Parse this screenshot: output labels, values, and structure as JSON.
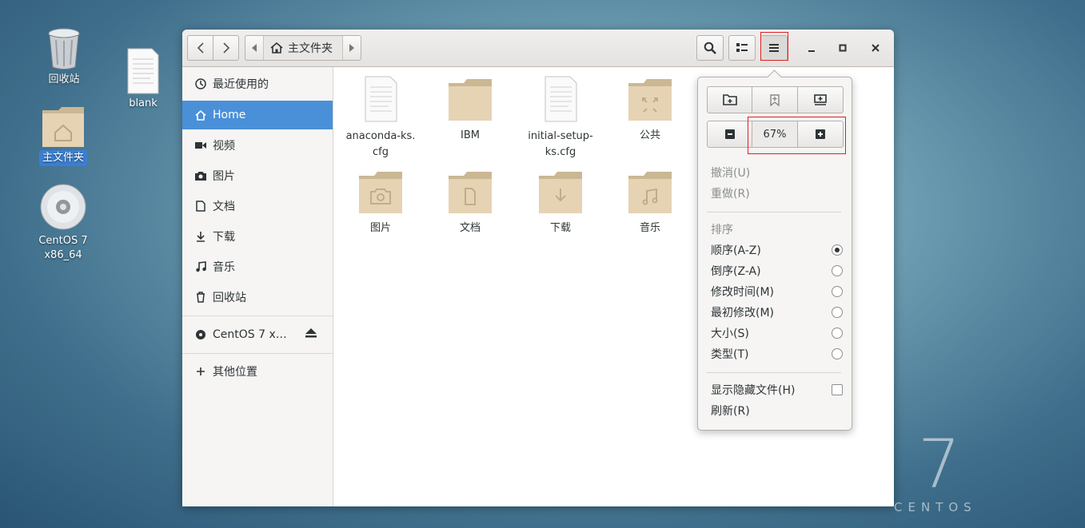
{
  "desktop": {
    "icons": [
      {
        "label": "回收站"
      },
      {
        "label": "blank"
      },
      {
        "label": "主文件夹"
      },
      {
        "label": "CentOS 7\nx86_64"
      }
    ],
    "logo": {
      "numeral": "7",
      "word": "CENTOS"
    }
  },
  "headerbar": {
    "breadcrumb": "主文件夹",
    "zoom_level": "67%"
  },
  "sidebar": {
    "items": [
      {
        "label": "最近使用的",
        "icon": "recent-icon"
      },
      {
        "label": "Home",
        "icon": "home-icon"
      },
      {
        "label": "视频",
        "icon": "video-icon"
      },
      {
        "label": "图片",
        "icon": "camera-icon"
      },
      {
        "label": "文档",
        "icon": "document-icon"
      },
      {
        "label": "下载",
        "icon": "download-icon"
      },
      {
        "label": "音乐",
        "icon": "music-icon"
      },
      {
        "label": "回收站",
        "icon": "trash-icon"
      },
      {
        "label": "CentOS 7 x…",
        "icon": "disc-icon"
      },
      {
        "label": "其他位置",
        "icon": "plus-icon"
      }
    ]
  },
  "files": [
    {
      "label": "anaconda-ks.\ncfg",
      "type": "text-file"
    },
    {
      "label": "IBM",
      "type": "folder"
    },
    {
      "label": "initial-setup-\nks.cfg",
      "type": "text-file"
    },
    {
      "label": "公共",
      "type": "folder-share"
    },
    {
      "label": "图片",
      "type": "folder-pictures"
    },
    {
      "label": "文档",
      "type": "folder-documents"
    },
    {
      "label": "下载",
      "type": "folder-download"
    },
    {
      "label": "音乐",
      "type": "folder-music"
    }
  ],
  "menu": {
    "undo": "撤消(U)",
    "redo": "重做(R)",
    "sort_title": "排序",
    "sort_options": [
      {
        "label": "顺序(A-Z)",
        "selected": true
      },
      {
        "label": "倒序(Z-A)",
        "selected": false
      },
      {
        "label": "修改时间(M)",
        "selected": false
      },
      {
        "label": "最初修改(M)",
        "selected": false
      },
      {
        "label": "大小(S)",
        "selected": false
      },
      {
        "label": "类型(T)",
        "selected": false
      }
    ],
    "show_hidden": "显示隐藏文件(H)",
    "show_hidden_checked": false,
    "reload": "刷新(R)"
  },
  "colors": {
    "accent": "#4a90d9",
    "highlight_box": "#e02020",
    "folder": "#e6d3b3"
  }
}
